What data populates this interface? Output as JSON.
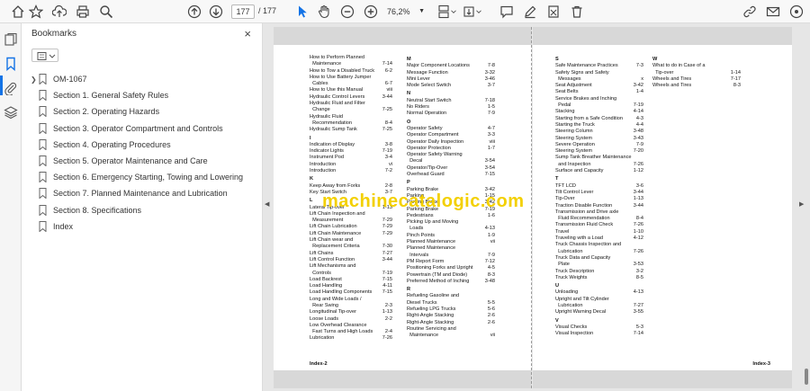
{
  "toolbar": {
    "page_current": "177",
    "page_separator": "/",
    "page_total": "177",
    "zoom": "76,2%"
  },
  "bookmarks_panel": {
    "title": "Bookmarks",
    "close": "×",
    "items": [
      {
        "label": "OM-1067",
        "expandable": true
      },
      {
        "label": "Section 1. General Safety Rules"
      },
      {
        "label": "Section 2. Operating Hazards"
      },
      {
        "label": "Section 3. Operator Compartment and Controls"
      },
      {
        "label": "Section 4. Operating Procedures"
      },
      {
        "label": "Section 5. Operator Maintenance and Care"
      },
      {
        "label": "Section 6. Emergency Starting, Towing and Lowering"
      },
      {
        "label": "Section 7. Planned Maintenance and Lubrication"
      },
      {
        "label": "Section 8. Specifications"
      },
      {
        "label": "Index"
      }
    ]
  },
  "watermark": "machinecatalogic.com",
  "left_page": {
    "footer": "Index-2",
    "col1": [
      [
        "How to Perform Planned",
        ""
      ],
      [
        "  Maintenance",
        "7-14"
      ],
      [
        "How to Tow a Disabled Truck",
        "6-2"
      ],
      [
        "How to Use Battery Jumper",
        ""
      ],
      [
        "  Cables",
        "6-7"
      ],
      [
        "How to Use this Manual",
        "viii"
      ],
      [
        "Hydraulic Control Levers",
        "3-44"
      ],
      [
        "Hydraulic Fluid and Filter",
        ""
      ],
      [
        "  Change",
        "7-25"
      ],
      [
        "Hydraulic Fluid",
        ""
      ],
      [
        "  Recommendation",
        "8-4"
      ],
      [
        "Hydraulic Sump Tank",
        "7-25"
      ],
      [
        "#I",
        ""
      ],
      [
        "Indication of Display",
        "3-8"
      ],
      [
        "Indicator Lights",
        "7-19"
      ],
      [
        "Instrument Pod",
        "3-4"
      ],
      [
        "Introduction",
        "vi"
      ],
      [
        "Introduction",
        "7-2"
      ],
      [
        "#K",
        ""
      ],
      [
        "Keep Away from Forks",
        "2-8"
      ],
      [
        "Key Start Switch",
        "3-7"
      ],
      [
        "#L",
        ""
      ],
      [
        "Lateral Tip-over",
        "1-13"
      ],
      [
        "Lift Chain Inspection and",
        ""
      ],
      [
        "  Measurement",
        "7-29"
      ],
      [
        "Lift Chain Lubrication",
        "7-29"
      ],
      [
        "Lift Chain Maintenance",
        "7-29"
      ],
      [
        "Lift Chain wear and",
        ""
      ],
      [
        "  Replacement Criteria",
        "7-30"
      ],
      [
        "Lift Chains",
        "7-27"
      ],
      [
        "Lift Control Function",
        "3-44"
      ],
      [
        "Lift Mechanisms and",
        ""
      ],
      [
        "  Controls",
        "7-19"
      ],
      [
        "Load Backrest",
        "7-15"
      ],
      [
        "Load Handling",
        "4-11"
      ],
      [
        "Load Handling Components",
        "7-15"
      ],
      [
        "Long and Wide Loads /",
        ""
      ],
      [
        "  Rear Swing",
        "2-3"
      ],
      [
        "Longitudinal Tip-over",
        "1-13"
      ],
      [
        "Loose Loads",
        "2-2"
      ],
      [
        "Low Overhead Clearance",
        ""
      ],
      [
        "  Fast Turns and High Loads",
        "2-4"
      ],
      [
        "Lubrication",
        "7-26"
      ]
    ],
    "col2": [
      [
        "#M",
        ""
      ],
      [
        "Major Component Locations",
        "7-8"
      ],
      [
        "Message Function",
        "3-32"
      ],
      [
        "Mini Lever",
        "3-46"
      ],
      [
        "Mode Select Switch",
        "3-7"
      ],
      [
        "#N",
        ""
      ],
      [
        "Neutral Start Switch",
        "7-18"
      ],
      [
        "No Riders",
        "1-5"
      ],
      [
        "Normal Operation",
        "7-9"
      ],
      [
        "#O",
        ""
      ],
      [
        "Operator Safety",
        "4-7"
      ],
      [
        "Operator Compartment",
        "3-3"
      ],
      [
        "Operator Daily Inspection",
        "viii"
      ],
      [
        "Operator Protection",
        "1-7"
      ],
      [
        "Operator Safety Warning",
        ""
      ],
      [
        "  Decal",
        "3-54"
      ],
      [
        "Operator/Tip-Over",
        "3-54"
      ],
      [
        "Overhead Guard",
        "7-15"
      ],
      [
        "#P",
        ""
      ],
      [
        "Parking Brake",
        "3-42"
      ],
      [
        "Parking",
        "1-15"
      ],
      [
        "Parking Brake",
        "3-42"
      ],
      [
        "Parking Brake",
        "7-19"
      ],
      [
        "Pedestrians",
        "1-6"
      ],
      [
        "Picking Up and Moving",
        ""
      ],
      [
        "  Loads",
        "4-13"
      ],
      [
        "Pinch Points",
        "1-9"
      ],
      [
        "Planned Maintenance",
        "vii"
      ],
      [
        "Planned Maintenance",
        ""
      ],
      [
        "  Intervals",
        "7-9"
      ],
      [
        "PM Report Form",
        "7-12"
      ],
      [
        "Positioning Forks and Upright",
        "4-5"
      ],
      [
        "Powertrain (TM and Diode)",
        "8-3"
      ],
      [
        "Preferred Method of Inching",
        "3-48"
      ],
      [
        "#R",
        ""
      ],
      [
        "Refueling Gasoline and",
        ""
      ],
      [
        "Diesel Trucks",
        "5-5"
      ],
      [
        "Refueling LPG Trucks",
        "5-6"
      ],
      [
        "Right-Angle Stacking",
        "2-6"
      ],
      [
        "Right-Angle Stacking",
        "2-6"
      ],
      [
        "Routine Servicing and",
        ""
      ],
      [
        "  Maintenance",
        "vii"
      ]
    ]
  },
  "right_page": {
    "footer": "Index-3",
    "col1": [
      [
        "#S",
        ""
      ],
      [
        "Safe Maintenance Practices",
        "7-3"
      ],
      [
        "Safety Signs and Safety",
        ""
      ],
      [
        "  Messages",
        "x"
      ],
      [
        "Seat Adjustment",
        "3-42"
      ],
      [
        "Seat Belts",
        "1-4"
      ],
      [
        "Service Brakes and Inching",
        ""
      ],
      [
        "  Pedal",
        "7-19"
      ],
      [
        "Stacking",
        "4-14"
      ],
      [
        "Starting from a Safe Condition",
        "4-3"
      ],
      [
        "Starting the Truck",
        "4-4"
      ],
      [
        "Steering Column",
        "3-48"
      ],
      [
        "Steering System",
        "3-43"
      ],
      [
        "Severe Operation",
        "7-9"
      ],
      [
        "Steering System",
        "7-20"
      ],
      [
        "Sump Tank Breather Maintenance",
        ""
      ],
      [
        "  and Inspection",
        "7-26"
      ],
      [
        "Surface and Capacity",
        "1-12"
      ],
      [
        "#T",
        ""
      ],
      [
        "TFT LCD",
        "3-6"
      ],
      [
        "Tilt Control Lever",
        "3-44"
      ],
      [
        "Tip-Over",
        "1-13"
      ],
      [
        "Traction Disable Function",
        "3-44"
      ],
      [
        "Transmission and Drive axle",
        ""
      ],
      [
        "  Fluid Recommendation",
        "8-4"
      ],
      [
        "Transmission Fluid Check",
        "7-26"
      ],
      [
        "Travel",
        "1-10"
      ],
      [
        "Traveling with a Load",
        "4-12"
      ],
      [
        "Truck Chassis Inspection and",
        ""
      ],
      [
        "  Lubrication",
        "7-26"
      ],
      [
        "Truck Data and Capacity",
        ""
      ],
      [
        "  Plate",
        "3-53"
      ],
      [
        "Truck Description",
        "3-2"
      ],
      [
        "Truck Weights",
        "8-5"
      ],
      [
        "#U",
        ""
      ],
      [
        "Unloading",
        "4-13"
      ],
      [
        "Upright and Tilt Cylinder",
        ""
      ],
      [
        "  Lubrication",
        "7-27"
      ],
      [
        "Upright Warning Decal",
        "3-55"
      ],
      [
        "#V",
        ""
      ],
      [
        "Visual Checks",
        "5-3"
      ],
      [
        "Visual Inspection",
        "7-14"
      ]
    ],
    "col2": [
      [
        "#W",
        ""
      ],
      [
        "What to do in Case of a",
        ""
      ],
      [
        "  Tip-over",
        "1-14"
      ],
      [
        "Wheels and Tires",
        "7-17"
      ],
      [
        "Wheels and Tires",
        "8-3"
      ]
    ]
  }
}
